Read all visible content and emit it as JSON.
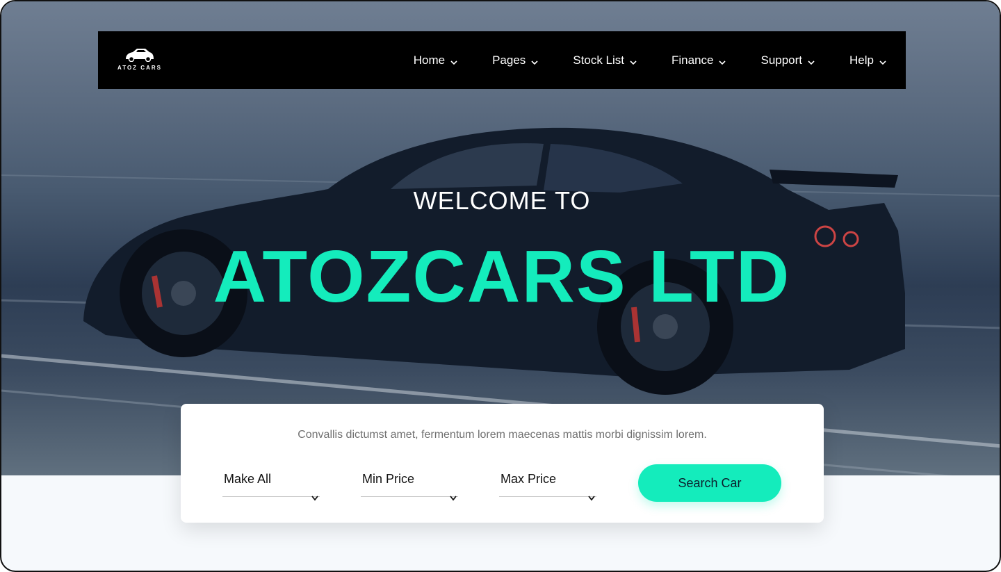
{
  "brand": {
    "logo_text": "ATOZ CARS"
  },
  "nav": {
    "items": [
      {
        "label": "Home"
      },
      {
        "label": "Pages"
      },
      {
        "label": "Stock List"
      },
      {
        "label": "Finance"
      },
      {
        "label": "Support"
      },
      {
        "label": "Help"
      }
    ]
  },
  "hero": {
    "welcome": "WELCOME TO",
    "title": "ATOZCARS LTD"
  },
  "search": {
    "description": "Convallis dictumst amet, fermentum lorem maecenas mattis morbi dignissim lorem.",
    "make_label": "Make All",
    "min_price_label": "Min Price",
    "max_price_label": "Max Price",
    "button_label": "Search Car"
  },
  "colors": {
    "accent": "#14ecbc",
    "nav_bg": "#000000"
  }
}
